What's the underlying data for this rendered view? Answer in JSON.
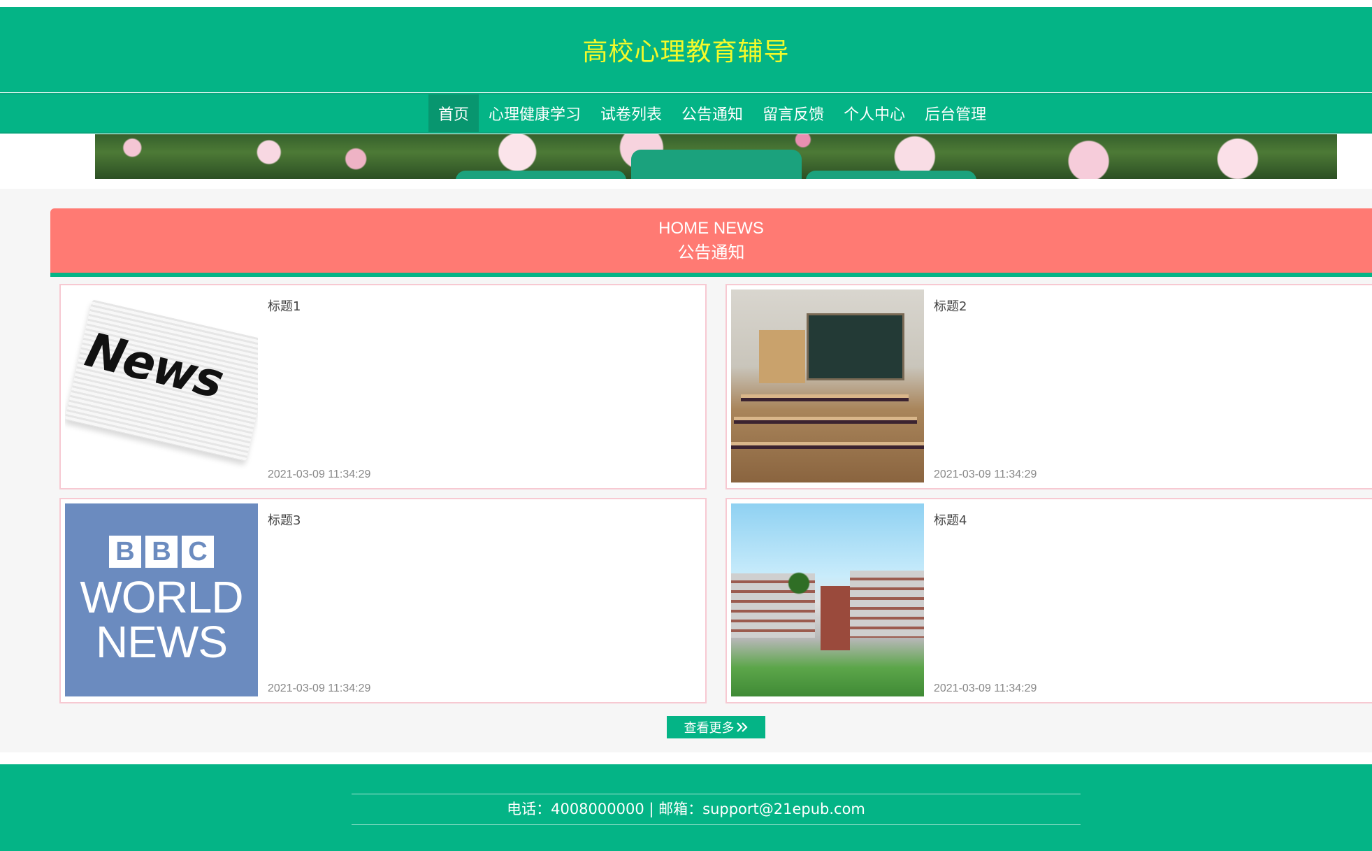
{
  "header": {
    "title": "高校心理教育辅导"
  },
  "nav": {
    "items": [
      {
        "label": "首页",
        "active": true
      },
      {
        "label": "心理健康学习"
      },
      {
        "label": "试卷列表"
      },
      {
        "label": "公告通知"
      },
      {
        "label": "留言反馈"
      },
      {
        "label": "个人中心"
      },
      {
        "label": "后台管理"
      }
    ]
  },
  "section": {
    "title_en": "HOME NEWS",
    "title_cn": "公告通知"
  },
  "news": [
    {
      "title": "标题1",
      "time": "2021-03-09 11:34:29",
      "image": "newspaper-image"
    },
    {
      "title": "标题2",
      "time": "2021-03-09 11:34:29",
      "image": "classroom-image"
    },
    {
      "title": "标题3",
      "time": "2021-03-09 11:34:29",
      "image": "bbc-world-news-image"
    },
    {
      "title": "标题4",
      "time": "2021-03-09 11:34:29",
      "image": "campus-image"
    }
  ],
  "images": {
    "news_word": "News",
    "bbc_letters": [
      "B",
      "B",
      "C"
    ],
    "bbc_line1": "WORLD",
    "bbc_line2": "NEWS"
  },
  "more": {
    "label": "查看更多",
    "icon": "double-chevron-right-icon"
  },
  "footer": {
    "contact": "电话：4008000000 | 邮箱：support@21epub.com"
  },
  "colors": {
    "brand": "#04b486",
    "title": "#f4fa2a",
    "section": "#ff7a73",
    "card_border": "#f7c9d2"
  }
}
